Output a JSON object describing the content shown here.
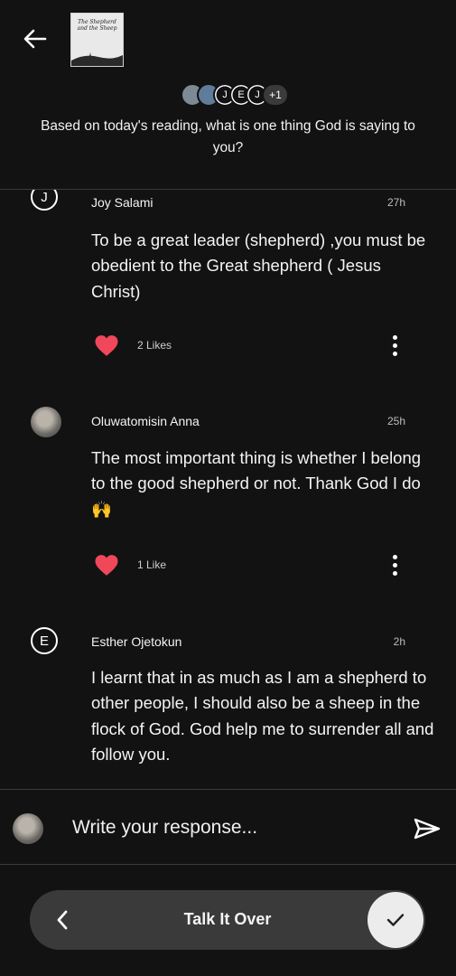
{
  "header": {
    "thumbnail_title": "The Shepherd and the Sheep",
    "participants": {
      "letters": [
        "J",
        "E",
        "J"
      ],
      "extra": "+1"
    },
    "question": "Based on today's reading, what is one thing God is saying to you?"
  },
  "comments": [
    {
      "avatar_letter": "J",
      "name": "Joy Salami",
      "time": "27h",
      "text": "To be a great leader (shepherd) ,you must be obedient to the Great shepherd ( Jesus Christ)",
      "likes": "2 Likes"
    },
    {
      "name": "Oluwatomisin Anna",
      "time": "25h",
      "text": "The most important thing is whether I belong to the good shepherd or not. Thank God I do🙌",
      "likes": "1 Like"
    },
    {
      "avatar_letter": "E",
      "name": "Esther Ojetokun",
      "time": "2h",
      "text": "I learnt that in as much as I am a shepherd to other people, I should also be a sheep in the flock of God. God help me to surrender all and follow you."
    }
  ],
  "composer": {
    "placeholder": "Write your response..."
  },
  "bottom_bar": {
    "title": "Talk It Over"
  },
  "colors": {
    "background": "#121212",
    "heart": "#f0475b",
    "pill": "#3a3a3a"
  }
}
